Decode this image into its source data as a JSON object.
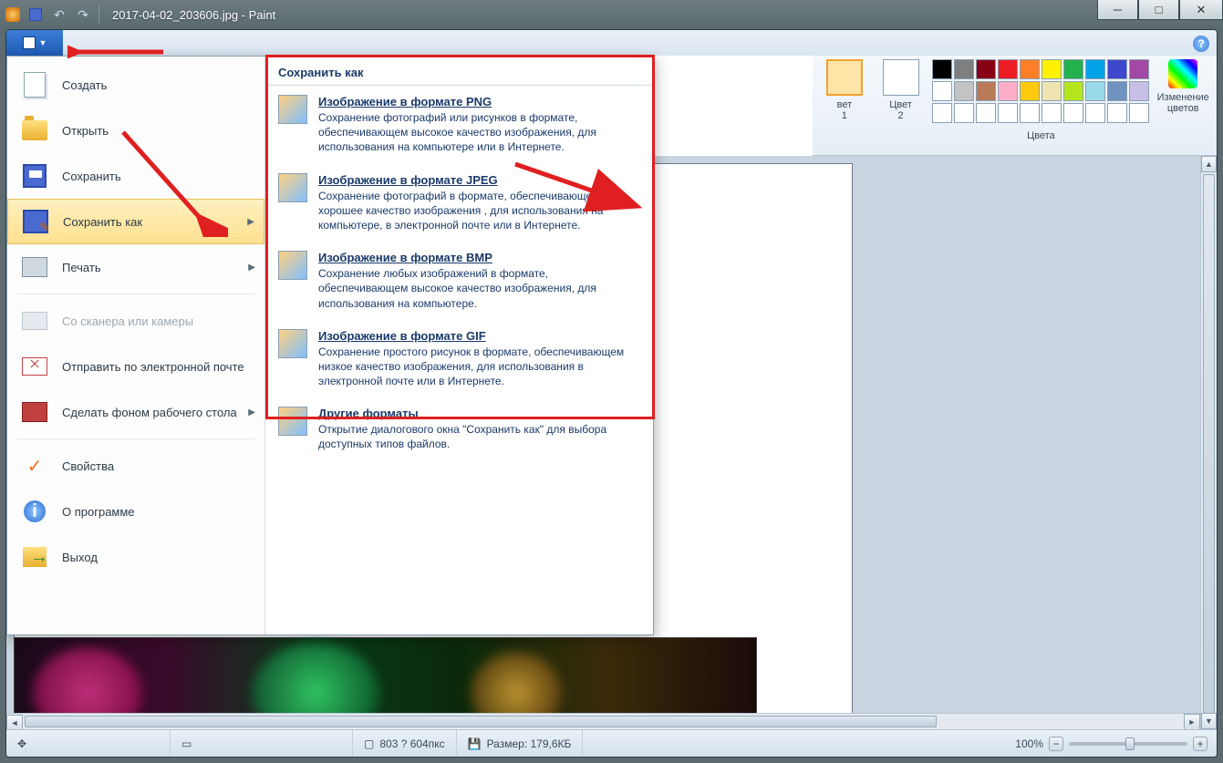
{
  "title": "2017-04-02_203606.jpg - Paint",
  "ribbon": {
    "color1_label_partial": "вет\n1",
    "color2_label": "Цвет\n2",
    "colors_label": "Цвета",
    "edit_colors_label": "Изменение\nцветов",
    "palette_row1": [
      "#000000",
      "#7f7f7f",
      "#880015",
      "#ed1c24",
      "#ff7f27",
      "#fff200",
      "#22b14c",
      "#00a2e8",
      "#3f48cc",
      "#a349a4"
    ],
    "palette_row2": [
      "#ffffff",
      "#c3c3c3",
      "#b97a57",
      "#ffaec9",
      "#ffc90e",
      "#efe4b0",
      "#b5e61d",
      "#99d9ea",
      "#7092be",
      "#c8bfe7"
    ],
    "palette_row3": [
      "#ffffff",
      "#ffffff",
      "#ffffff",
      "#ffffff",
      "#ffffff",
      "#ffffff",
      "#ffffff",
      "#ffffff",
      "#ffffff",
      "#ffffff"
    ]
  },
  "file_menu": {
    "items": [
      {
        "label": "Создать"
      },
      {
        "label": "Открыть"
      },
      {
        "label": "Сохранить"
      },
      {
        "label": "Сохранить как",
        "arrow": true,
        "selected": true
      },
      {
        "label": "Печать",
        "arrow": true
      },
      {
        "label": "Со сканера или камеры",
        "disabled": true
      },
      {
        "label": "Отправить по электронной почте"
      },
      {
        "label": "Сделать фоном рабочего стола",
        "arrow": true
      },
      {
        "label": "Свойства"
      },
      {
        "label": "О программе"
      },
      {
        "label": "Выход"
      }
    ]
  },
  "submenu": {
    "title": "Сохранить как",
    "items": [
      {
        "title": "Изображение в формате PNG",
        "desc": "Сохранение фотографий или рисунков в формате, обеспечивающем высокое качество изображения, для использования на компьютере или в Интернете."
      },
      {
        "title": "Изображение в формате JPEG",
        "desc": "Сохранение фотографий в формате, обеспечивающем хорошее качество изображения , для использования на компьютере, в электронной почте или в Интернете."
      },
      {
        "title": "Изображение в формате BMP",
        "desc": "Сохранение любых изображений в формате, обеспечивающем высокое качество изображения, для использования на компьютере."
      },
      {
        "title": "Изображение в формате GIF",
        "desc": "Сохранение простого рисунок в формате, обеспечивающем низкое качество изображения, для использования в электронной почте или в Интернете."
      },
      {
        "title": "Другие форматы",
        "desc": "Открытие диалогового окна \"Сохранить как\" для выбора доступных типов файлов."
      }
    ]
  },
  "status": {
    "dimensions": "803 ? 604пкс",
    "size_label": "Размер: 179,6КБ",
    "zoom": "100%"
  }
}
